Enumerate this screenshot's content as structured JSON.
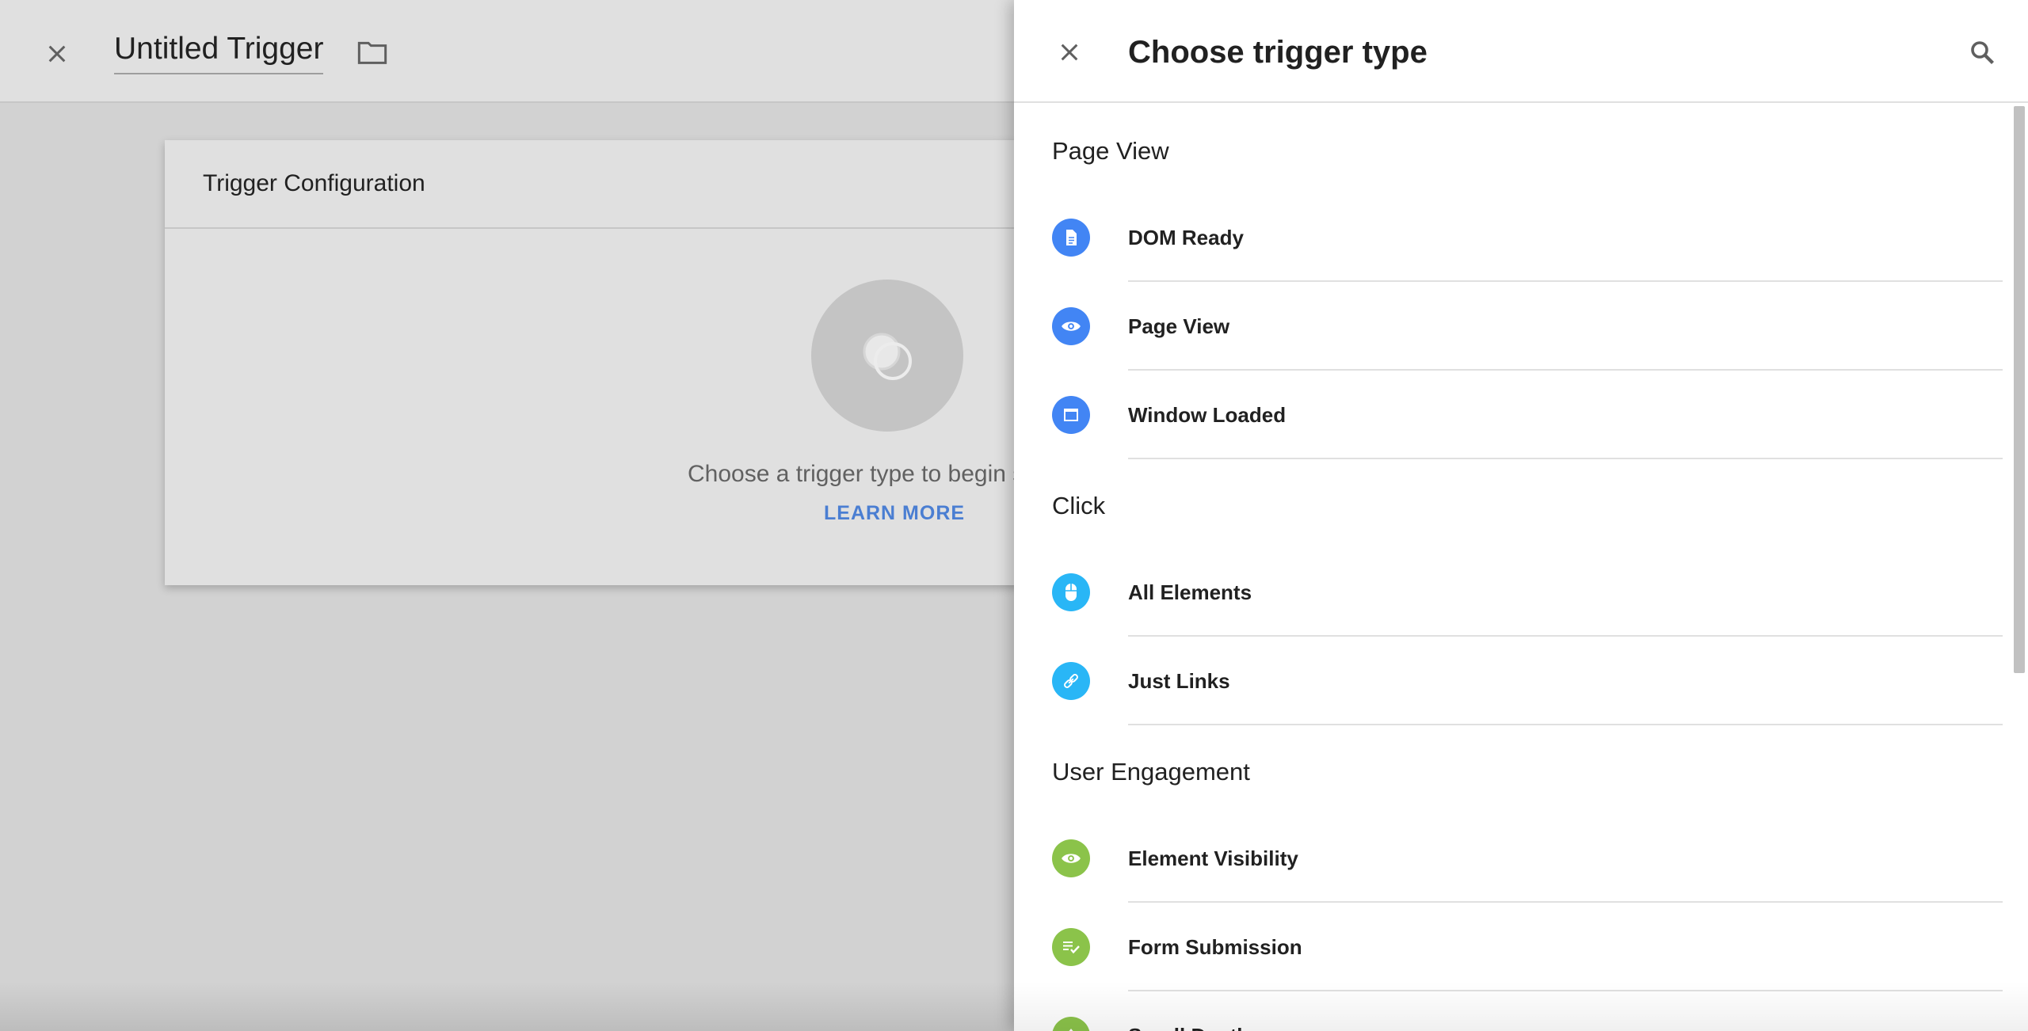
{
  "editor": {
    "title": "Untitled Trigger",
    "card_header": "Trigger Configuration",
    "empty_text": "Choose a trigger type to begin setup...",
    "learn_more": "LEARN MORE"
  },
  "panel": {
    "title": "Choose trigger type",
    "groups": [
      {
        "title": "Page View",
        "items": [
          {
            "label": "DOM Ready",
            "icon": "document-icon",
            "color": "#4285f4"
          },
          {
            "label": "Page View",
            "icon": "eye-icon",
            "color": "#4285f4"
          },
          {
            "label": "Window Loaded",
            "icon": "window-icon",
            "color": "#4285f4"
          }
        ]
      },
      {
        "title": "Click",
        "items": [
          {
            "label": "All Elements",
            "icon": "mouse-icon",
            "color": "#29b6f6"
          },
          {
            "label": "Just Links",
            "icon": "link-icon",
            "color": "#29b6f6"
          }
        ]
      },
      {
        "title": "User Engagement",
        "items": [
          {
            "label": "Element Visibility",
            "icon": "eye-icon",
            "color": "#8bc34a"
          },
          {
            "label": "Form Submission",
            "icon": "form-check-icon",
            "color": "#8bc34a"
          },
          {
            "label": "Scroll Depth",
            "icon": "scroll-depth-icon",
            "color": "#8bc34a"
          }
        ]
      }
    ]
  }
}
